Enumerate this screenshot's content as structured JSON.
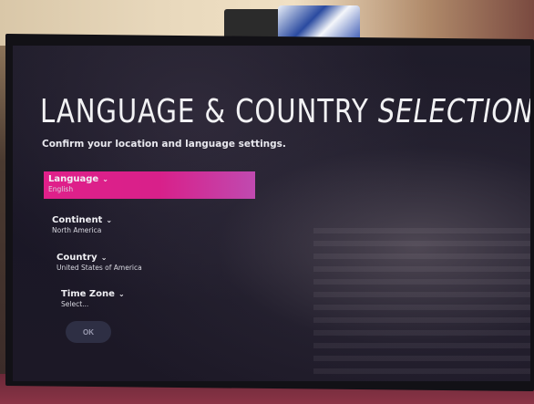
{
  "screen": {
    "title_main": "LANGUAGE & COUNTRY ",
    "title_italic": "SELECTION",
    "subtitle": "Confirm your location and language settings."
  },
  "menu": {
    "items": [
      {
        "label": "Language",
        "value": "English",
        "selected": true
      },
      {
        "label": "Continent",
        "value": "North America",
        "selected": false
      },
      {
        "label": "Country",
        "value": "United States of America",
        "selected": false
      },
      {
        "label": "Time Zone",
        "value": "Select...",
        "selected": false
      }
    ],
    "ok_label": "OK"
  },
  "icons": {
    "dropdown": "chevron-down-icon"
  },
  "colors": {
    "selected_item": "#e0208a",
    "screen_background": "#1c1826",
    "text": "#f0f0f4",
    "ok_button": "#2e2f44"
  }
}
